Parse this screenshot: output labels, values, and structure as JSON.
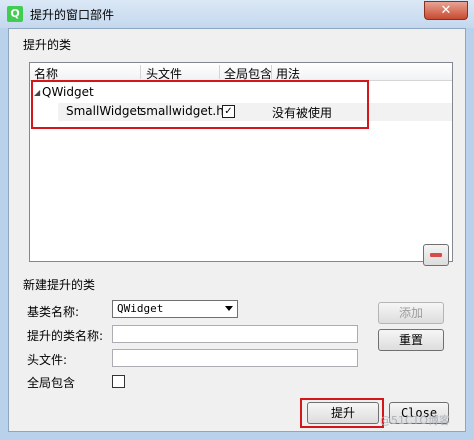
{
  "window": {
    "title": "提升的窗口部件",
    "close_glyph": "✕",
    "app_icon_glyph": "Q"
  },
  "promoted_group": {
    "legend": "提升的类",
    "columns": [
      "名称",
      "头文件",
      "全局包含",
      "用法"
    ],
    "base_node": "QWidget",
    "rows": [
      {
        "name": "SmallWidget",
        "header": "smallwidget.h",
        "global_include": true,
        "usage": "没有被使用"
      }
    ],
    "check_mark": "✓"
  },
  "new_group": {
    "legend": "新建提升的类",
    "base_class_label": "基类名称:",
    "base_class_value": "QWidget",
    "class_name_label": "提升的类名称:",
    "class_name_value": "",
    "header_label": "头文件:",
    "header_value": "",
    "global_include_label": "全局包含",
    "global_include_checked": false,
    "add_button": "添加",
    "reset_button": "重置"
  },
  "footer": {
    "promote_button": "提升",
    "close_button": "Close"
  },
  "watermark": "@51CTO博客",
  "colors": {
    "highlight": "#d2161a",
    "titlebar": "#c4d8ee"
  }
}
